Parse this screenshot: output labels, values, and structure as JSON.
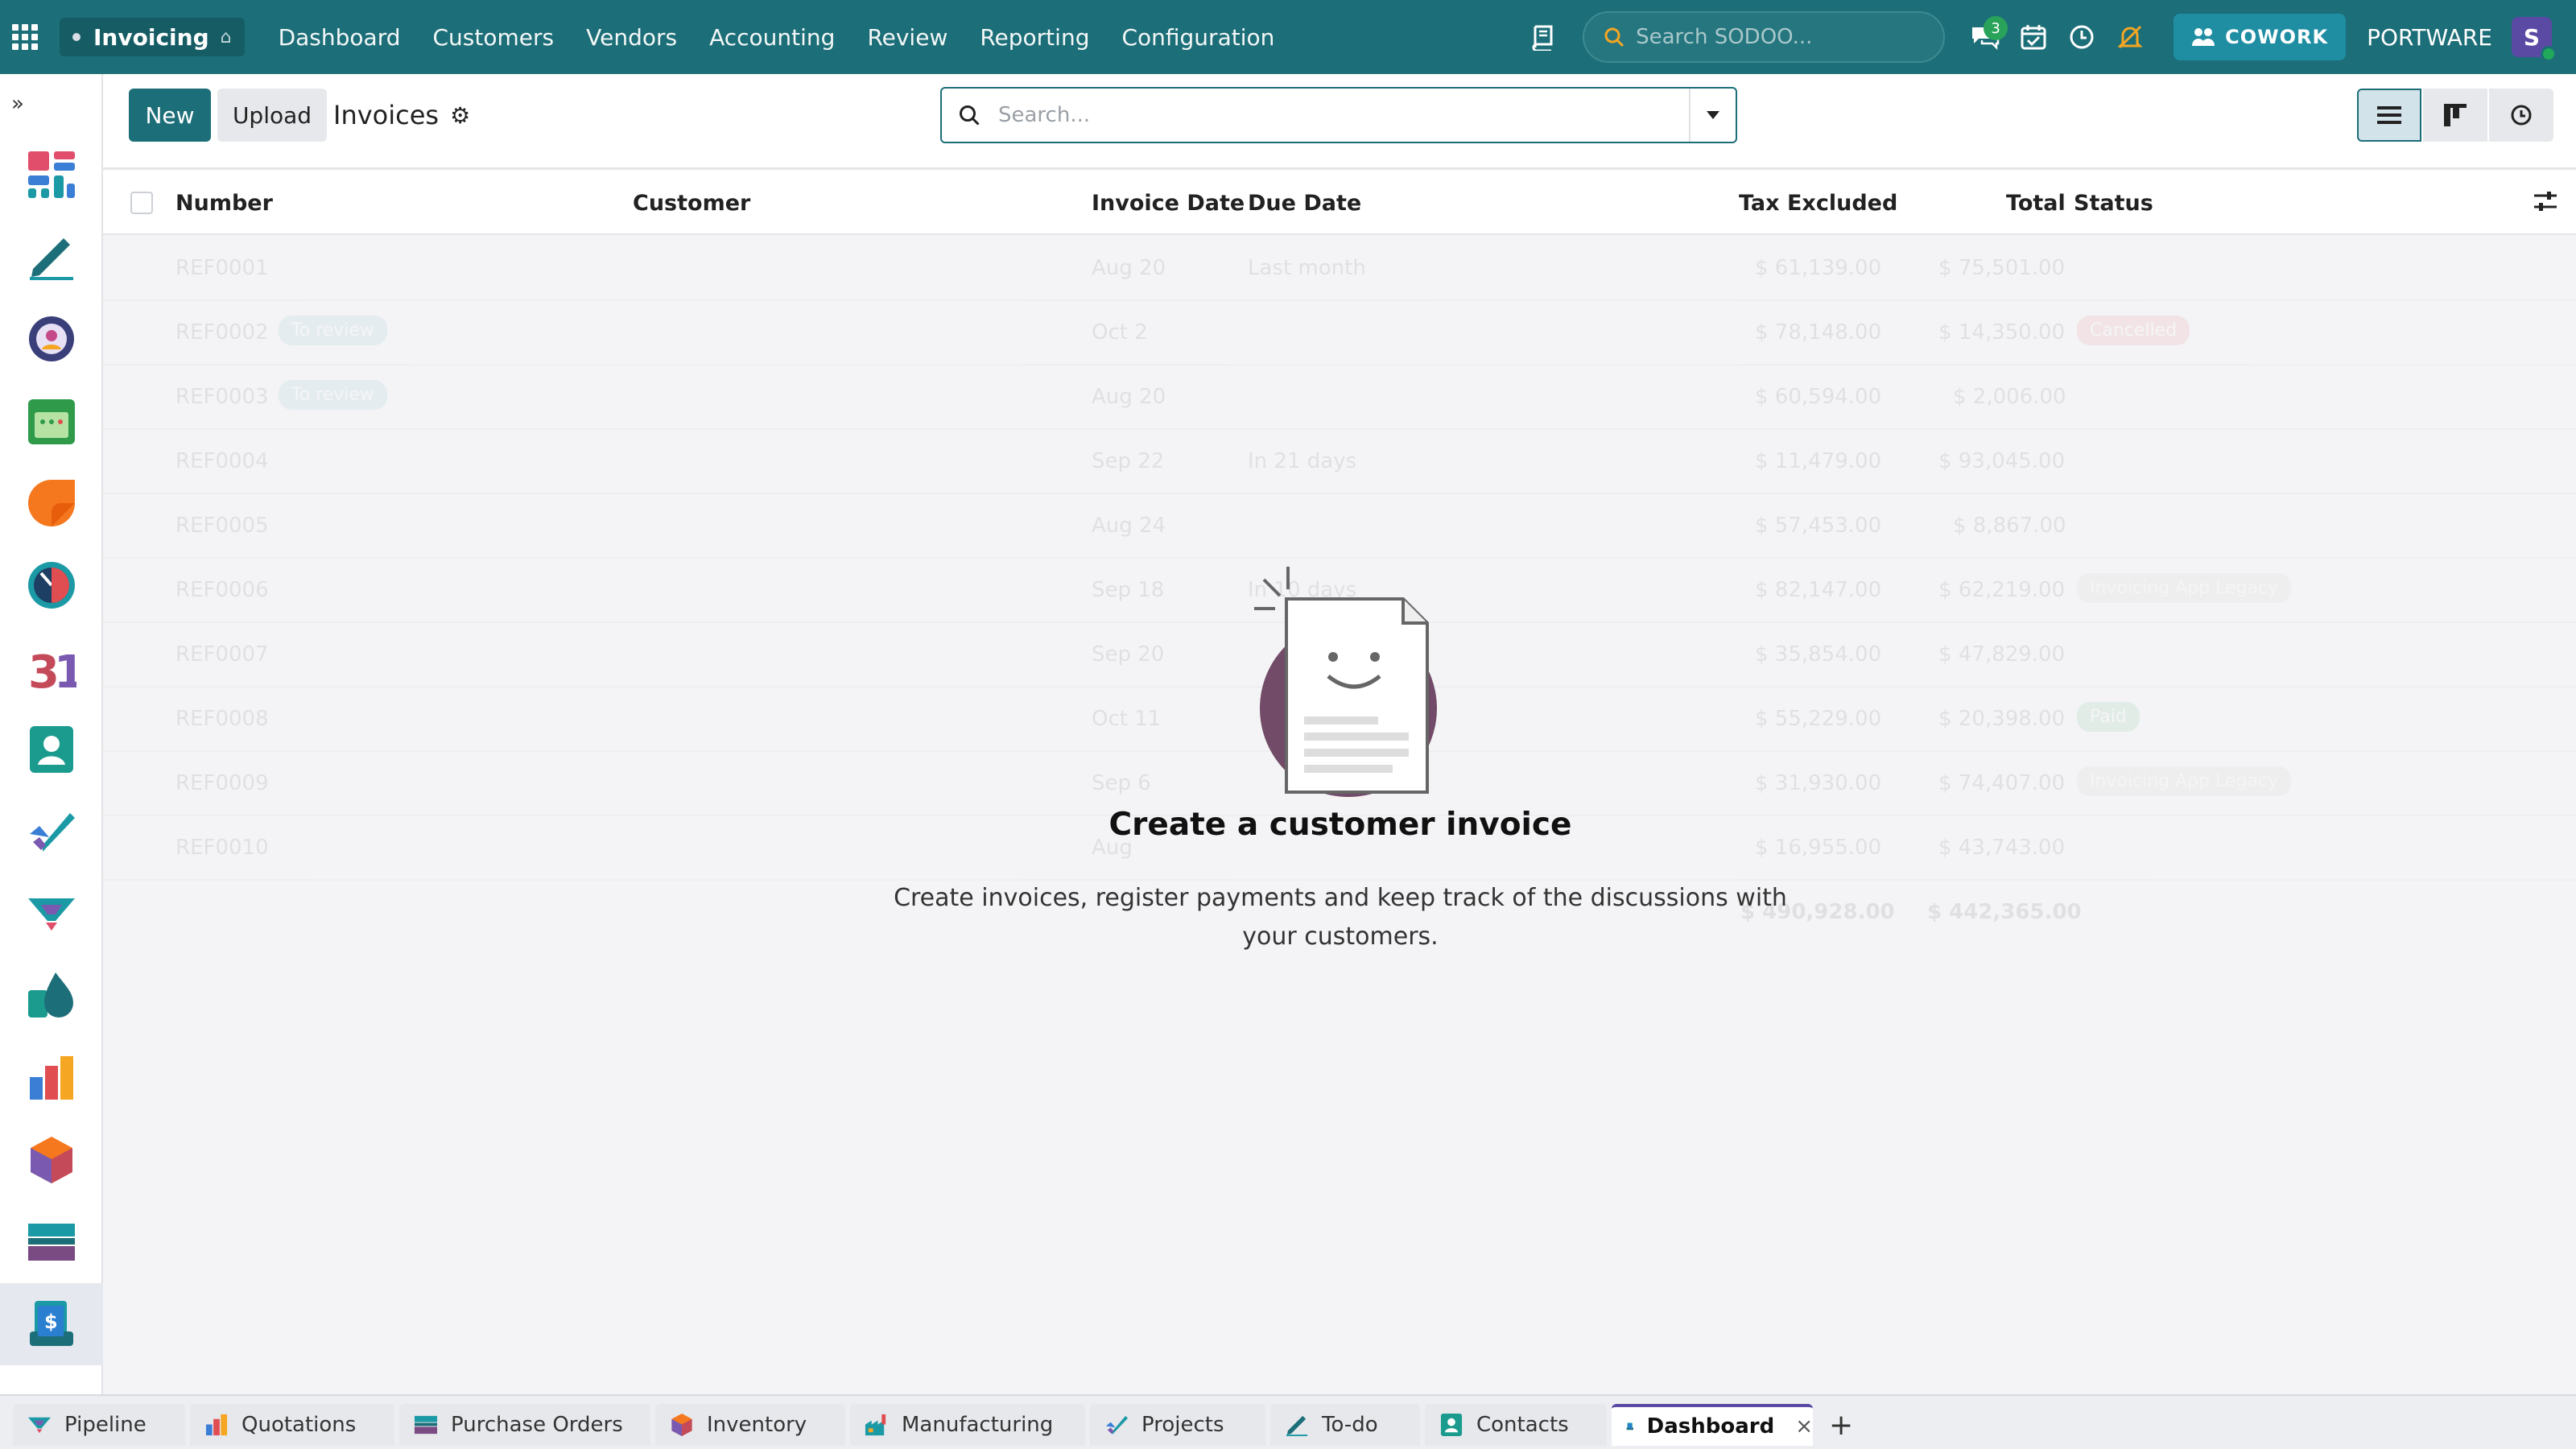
{
  "topbar": {
    "app_name": "Invoicing",
    "menu": [
      "Dashboard",
      "Customers",
      "Vendors",
      "Accounting",
      "Review",
      "Reporting",
      "Configuration"
    ],
    "search_placeholder": "Search SODOO...",
    "messages_count": "3",
    "cowork_label": "COWORK",
    "company": "PORTWARE",
    "avatar_initial": "S",
    "accent": "#1c6e78"
  },
  "sidebar": {
    "collapse_glyph": "»",
    "items": [
      "dashboards-icon",
      "sign-icon",
      "crm-icon",
      "calendar-icon",
      "notes-icon",
      "timesheet-icon",
      "calendar-31-icon",
      "contacts-icon",
      "todo-icon",
      "pipeline-icon",
      "discuss-icon",
      "reporting-icon",
      "inventory-icon",
      "purchase-icon",
      "invoicing-icon"
    ]
  },
  "control": {
    "new_label": "New",
    "upload_label": "Upload",
    "breadcrumb": "Invoices",
    "search_placeholder": "Search..."
  },
  "table": {
    "headers": {
      "number": "Number",
      "customer": "Customer",
      "invoice_date": "Invoice Date",
      "due_date": "Due Date",
      "tax_excluded": "Tax Excluded",
      "total": "Total",
      "status": "Status"
    },
    "rows": [
      {
        "number": "REF0001",
        "tag": "",
        "invoice_date": "Aug 20",
        "due_date": "Last month",
        "tax_excluded": "$ 61,139.00",
        "total": "$ 75,501.00",
        "status": ""
      },
      {
        "number": "REF0002",
        "tag": "To review",
        "invoice_date": "Oct 2",
        "due_date": "",
        "tax_excluded": "$ 78,148.00",
        "total": "$ 14,350.00",
        "status": "Cancelled"
      },
      {
        "number": "REF0003",
        "tag": "To review",
        "invoice_date": "Aug 20",
        "due_date": "",
        "tax_excluded": "$ 60,594.00",
        "total": "$ 2,006.00",
        "status": ""
      },
      {
        "number": "REF0004",
        "tag": "",
        "invoice_date": "Sep 22",
        "due_date": "In 21 days",
        "tax_excluded": "$ 11,479.00",
        "total": "$ 93,045.00",
        "status": ""
      },
      {
        "number": "REF0005",
        "tag": "",
        "invoice_date": "Aug 24",
        "due_date": "",
        "tax_excluded": "$ 57,453.00",
        "total": "$ 8,867.00",
        "status": ""
      },
      {
        "number": "REF0006",
        "tag": "",
        "invoice_date": "Sep 18",
        "due_date": "In 10 days",
        "tax_excluded": "$ 82,147.00",
        "total": "$ 62,219.00",
        "status": "Invoicing App Legacy"
      },
      {
        "number": "REF0007",
        "tag": "",
        "invoice_date": "Sep 20",
        "due_date": "",
        "tax_excluded": "$ 35,854.00",
        "total": "$ 47,829.00",
        "status": ""
      },
      {
        "number": "REF0008",
        "tag": "",
        "invoice_date": "Oct 11",
        "due_date": "",
        "tax_excluded": "$ 55,229.00",
        "total": "$ 20,398.00",
        "status": "Paid"
      },
      {
        "number": "REF0009",
        "tag": "",
        "invoice_date": "Sep 6",
        "due_date": "",
        "tax_excluded": "$ 31,930.00",
        "total": "$ 74,407.00",
        "status": "Invoicing App Legacy"
      },
      {
        "number": "REF0010",
        "tag": "",
        "invoice_date": "Aug",
        "due_date": "",
        "tax_excluded": "$ 16,955.00",
        "total": "$ 43,743.00",
        "status": ""
      }
    ],
    "totals": {
      "tax_excluded": "$ 490,928.00",
      "total": "$ 442,365.00"
    }
  },
  "empty_state": {
    "title": "Create a customer invoice",
    "text": "Create invoices, register payments and keep track of the discussions with your customers."
  },
  "bottom_tabs": [
    {
      "label": "Pipeline",
      "icon": "pipeline-icon",
      "active": false
    },
    {
      "label": "Quotations",
      "icon": "quotations-icon",
      "active": false
    },
    {
      "label": "Purchase Orders",
      "icon": "purchase-icon",
      "active": false
    },
    {
      "label": "Inventory",
      "icon": "inventory-icon",
      "active": false
    },
    {
      "label": "Manufacturing",
      "icon": "manufacturing-icon",
      "active": false
    },
    {
      "label": "Projects",
      "icon": "projects-icon",
      "active": false
    },
    {
      "label": "To-do",
      "icon": "todo-icon",
      "active": false
    },
    {
      "label": "Contacts",
      "icon": "contacts-icon",
      "active": false
    },
    {
      "label": "Dashboard",
      "icon": "invoicing-icon",
      "active": true
    }
  ],
  "bottom_close_glyph": "×",
  "bottom_add_glyph": "+"
}
